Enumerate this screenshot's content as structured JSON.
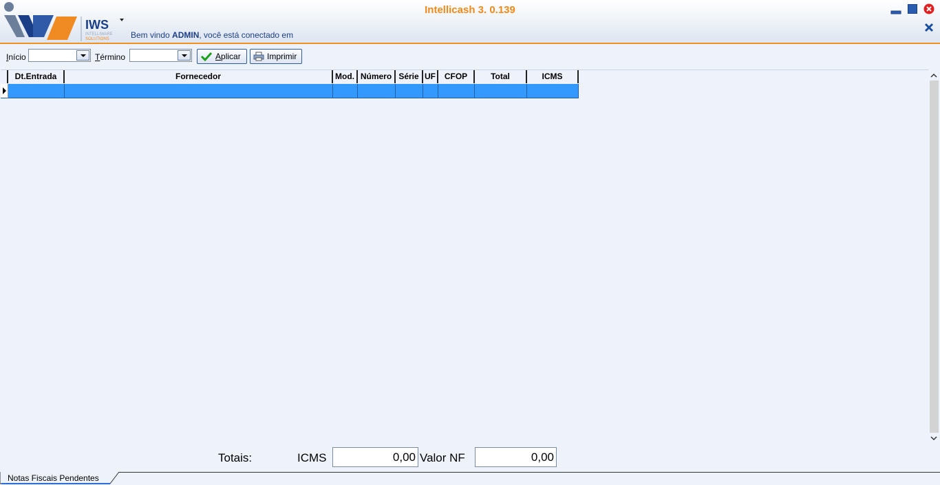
{
  "app": {
    "title": "Intellicash 3. 0.139",
    "logo_text": "IWS",
    "logo_subtext": "INTELLIWARE SOLUTIONS",
    "welcome_prefix": "Bem vindo ",
    "welcome_user": "ADMIN",
    "welcome_suffix": ", você está conectado em"
  },
  "toolbar": {
    "start_label_first": "I",
    "start_label_rest": "nício",
    "start_value": "",
    "end_label_first": "T",
    "end_label_rest": "érmino",
    "end_value": "",
    "apply_first": "A",
    "apply_rest": "plicar",
    "print_label": "Imprimir"
  },
  "grid": {
    "columns": [
      "Dt.Entrada",
      "Fornecedor",
      "Mod.",
      "Número",
      "Série",
      "UF",
      "CFOP",
      "Total",
      "ICMS"
    ],
    "rows": [
      [
        "",
        "",
        "",
        "",
        "",
        "",
        "",
        "",
        ""
      ]
    ]
  },
  "totals": {
    "label": "Totais:",
    "icms_label": "ICMS",
    "icms_value": "0,00",
    "valor_nf_label": "Valor NF",
    "valor_nf_value": "0,00"
  },
  "tabs": [
    "Notas Fiscais Pendentes"
  ],
  "colors": {
    "accent_orange": "#ef8a1a",
    "selection_blue": "#3399ff",
    "logo_blue": "#1b3f86"
  }
}
